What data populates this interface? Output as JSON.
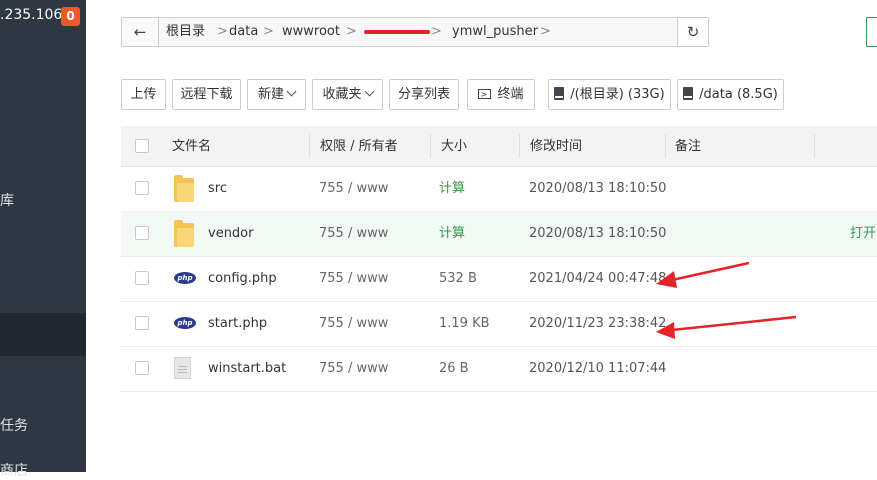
{
  "sidebar": {
    "ip_text": ".235.106",
    "badge": "0",
    "frag_1": "库",
    "frag_2": "任务",
    "frag_3": "商店"
  },
  "pathbar": {
    "back_icon": "←",
    "segments": [
      "根目录",
      "data",
      "wwwroot",
      "ymwl_pusher"
    ],
    "separator": ">",
    "refresh_icon": "↻"
  },
  "toolbar": {
    "upload": "上传",
    "remote_download": "远程下载",
    "new": "新建",
    "favorites": "收藏夹",
    "share_list": "分享列表",
    "terminal": "终端",
    "disk_root": "/(根目录) (33G)",
    "disk_data": "/data (8.5G)"
  },
  "table": {
    "headers": {
      "name": "文件名",
      "perm": "权限 / 所有者",
      "size": "大小",
      "mtime": "修改时间",
      "remark": "备注"
    },
    "rows": [
      {
        "name": "src",
        "perm": "755 / www",
        "size": "计算",
        "mtime": "2020/08/13 18:10:50",
        "icon": "folder-icon",
        "action": ""
      },
      {
        "name": "vendor",
        "perm": "755 / www",
        "size": "计算",
        "mtime": "2020/08/13 18:10:50",
        "icon": "folder-icon",
        "action": "打开"
      },
      {
        "name": "config.php",
        "perm": "755 / www",
        "size": "532 B",
        "mtime": "2021/04/24 00:47:48",
        "icon": "php-icon",
        "action": ""
      },
      {
        "name": "start.php",
        "perm": "755 / www",
        "size": "1.19 KB",
        "mtime": "2020/11/23 23:38:42",
        "icon": "php-icon",
        "action": ""
      },
      {
        "name": "winstart.bat",
        "perm": "755 / www",
        "size": "26 B",
        "mtime": "2020/12/10 11:07:44",
        "icon": "file-icon",
        "action": ""
      }
    ]
  },
  "icons": {
    "php_label": "php"
  },
  "colors": {
    "sidebar_bg": "#2f3742",
    "accent_green": "#2c9e4b",
    "badge_orange": "#f0582c",
    "annotation_red": "#e5232a"
  }
}
